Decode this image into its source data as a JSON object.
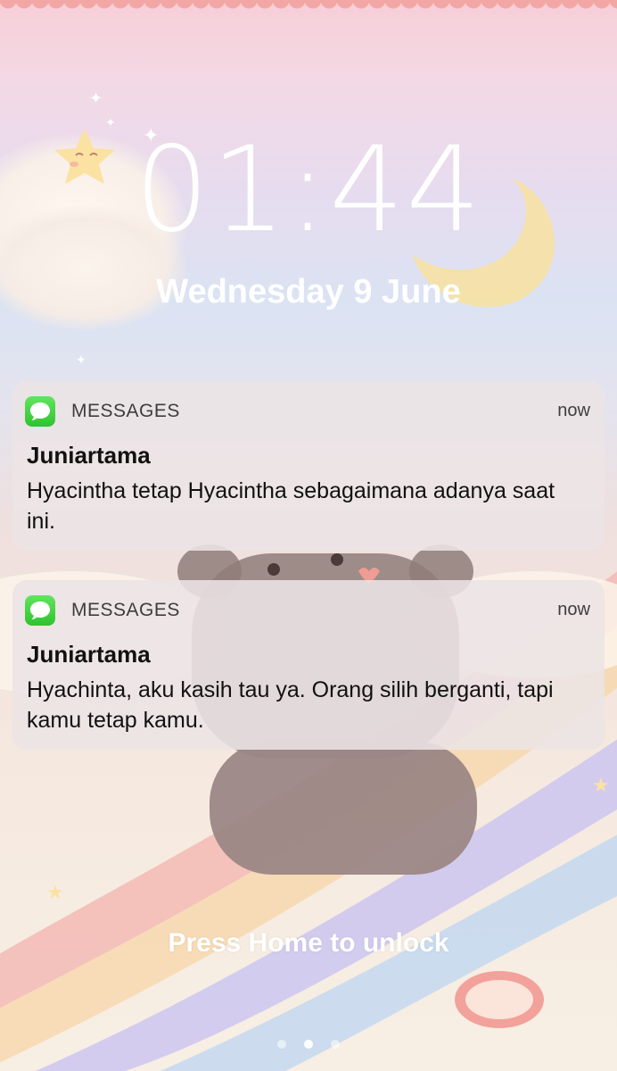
{
  "lockscreen": {
    "time": "01:44",
    "date": "Wednesday 9 June",
    "unlock_hint": "Press Home to unlock"
  },
  "notifications": [
    {
      "app": "MESSAGES",
      "app_icon": "messages-icon",
      "time": "now",
      "sender": "Juniartama",
      "body": "Hyacintha tetap Hyacintha sebagaimana adanya saat ini."
    },
    {
      "app": "MESSAGES",
      "app_icon": "messages-icon",
      "time": "now",
      "sender": "Juniartama",
      "body": "Hyachinta, aku kasih tau ya. Orang silih berganti, tapi kamu tetap kamu."
    }
  ],
  "colors": {
    "messages_green": "#34c434",
    "notification_bg": "#ece4e5",
    "text_white": "#ffffff"
  }
}
